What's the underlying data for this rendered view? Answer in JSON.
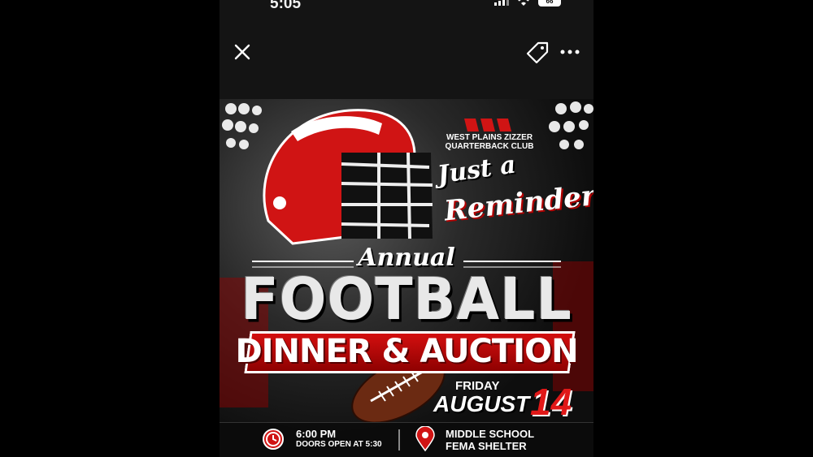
{
  "status_bar": {
    "time": "5:05",
    "battery": "66"
  },
  "toolbar": {
    "close_icon": "close-icon",
    "tag_icon": "tag-icon",
    "more_icon": "more-icon"
  },
  "flyer": {
    "club_name": "WEST PLAINS ZIZZER QUARTERBACK CLUB",
    "reminder_line1": "Just a",
    "reminder_line2": "Reminder!",
    "annual": "Annual",
    "football": "FOOTBALL",
    "dinner_auction": "DINNER & AUCTION",
    "day_of_week": "FRIDAY",
    "month": "AUGUST",
    "day": "14",
    "time": "6:00 PM",
    "doors": "DOORS OPEN AT 5:30",
    "location_line1": "MIDDLE SCHOOL",
    "location_line2": "FEMA SHELTER",
    "colors": {
      "accent": "#d81010",
      "dark": "#141414"
    }
  }
}
